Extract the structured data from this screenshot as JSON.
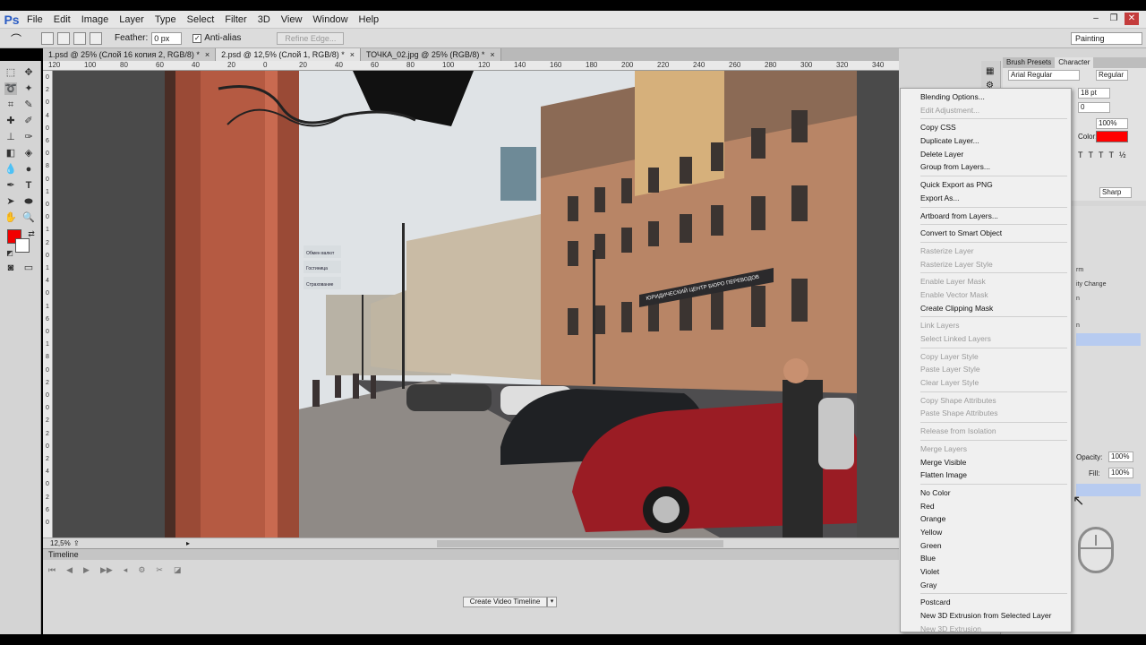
{
  "app": {
    "logo": "Ps"
  },
  "menubar": [
    "File",
    "Edit",
    "Image",
    "Layer",
    "Type",
    "Select",
    "Filter",
    "3D",
    "View",
    "Window",
    "Help"
  ],
  "window_controls": {
    "minimize": "–",
    "restore": "❐",
    "close": "✕"
  },
  "options_bar": {
    "feather_label": "Feather:",
    "feather_value": "0 px",
    "anti_alias_label": "Anti-alias",
    "anti_alias_checked": "✓",
    "refine_edge_label": "Refine Edge...",
    "workspace": "Painting"
  },
  "tabs": [
    {
      "label": "1.psd @ 25% (Слой 16 копия 2, RGB/8) *",
      "close": "×"
    },
    {
      "label": "2.psd @ 12,5% (Слой 1, RGB/8) *",
      "close": "×"
    },
    {
      "label": "ТОЧКА_02.jpg @ 25% (RGB/8) *",
      "close": "×"
    }
  ],
  "ruler_top": [
    "120",
    "100",
    "80",
    "60",
    "40",
    "20",
    "0",
    "20",
    "40",
    "60",
    "80",
    "100",
    "120",
    "140",
    "160",
    "180",
    "200",
    "220",
    "240",
    "260",
    "280",
    "300",
    "320",
    "340",
    "360",
    "370"
  ],
  "ruler_left": [
    "0",
    "2",
    "0",
    "4",
    "0",
    "6",
    "0",
    "8",
    "0",
    "1",
    "0",
    "0",
    "1",
    "2",
    "0",
    "1",
    "4",
    "0",
    "1",
    "6",
    "0",
    "1",
    "8",
    "0",
    "2",
    "0",
    "0",
    "2",
    "2",
    "0",
    "2",
    "4",
    "0",
    "2",
    "6",
    "0"
  ],
  "photo_signs": {
    "shop_sign": "ЮРИДИЧЕСКИЙ ЦЕНТР БЮРО ПЕРЕВОДОВ",
    "street_sign_1": "Обмен валют",
    "street_sign_2": "Гостиница",
    "street_sign_3": "Страхование"
  },
  "status": {
    "zoom": "12,5%"
  },
  "timeline": {
    "title": "Timeline",
    "create_button": "Create Video Timeline",
    "dropdown": "▾"
  },
  "character_panel": {
    "tabs": [
      "Brush Presets",
      "Character"
    ],
    "font_family": "Arial Regular",
    "font_style": "Regular",
    "font_size": "18 pt",
    "tracking": "0",
    "scale": "100%",
    "color_label": "Color:",
    "color": "#ff0000",
    "anti_alias": "Sharp",
    "type_buttons": [
      "T",
      "T",
      "T",
      "T",
      "½"
    ]
  },
  "layers_panel": {
    "rows": [
      "rm",
      "ity Change",
      "n",
      "n"
    ],
    "opacity_label": "Opacity:",
    "opacity_value": "100%",
    "fill_label": "Fill:",
    "fill_value": "100%"
  },
  "context_menu": [
    {
      "label": "Blending Options...",
      "disabled": false
    },
    {
      "label": "Edit Adjustment...",
      "disabled": true
    },
    {
      "sep": true
    },
    {
      "label": "Copy CSS",
      "disabled": false
    },
    {
      "label": "Duplicate Layer...",
      "disabled": false
    },
    {
      "label": "Delete Layer",
      "disabled": false
    },
    {
      "label": "Group from Layers...",
      "disabled": false
    },
    {
      "sep": true
    },
    {
      "label": "Quick Export as PNG",
      "disabled": false
    },
    {
      "label": "Export As...",
      "disabled": false
    },
    {
      "sep": true
    },
    {
      "label": "Artboard from Layers...",
      "disabled": false
    },
    {
      "sep": true
    },
    {
      "label": "Convert to Smart Object",
      "disabled": false
    },
    {
      "sep": true
    },
    {
      "label": "Rasterize Layer",
      "disabled": true
    },
    {
      "label": "Rasterize Layer Style",
      "disabled": true
    },
    {
      "sep": true
    },
    {
      "label": "Enable Layer Mask",
      "disabled": true
    },
    {
      "label": "Enable Vector Mask",
      "disabled": true
    },
    {
      "label": "Create Clipping Mask",
      "disabled": false
    },
    {
      "sep": true
    },
    {
      "label": "Link Layers",
      "disabled": true
    },
    {
      "label": "Select Linked Layers",
      "disabled": true
    },
    {
      "sep": true
    },
    {
      "label": "Copy Layer Style",
      "disabled": true
    },
    {
      "label": "Paste Layer Style",
      "disabled": true
    },
    {
      "label": "Clear Layer Style",
      "disabled": true
    },
    {
      "sep": true
    },
    {
      "label": "Copy Shape Attributes",
      "disabled": true
    },
    {
      "label": "Paste Shape Attributes",
      "disabled": true
    },
    {
      "sep": true
    },
    {
      "label": "Release from Isolation",
      "disabled": true
    },
    {
      "sep": true
    },
    {
      "label": "Merge Layers",
      "disabled": true
    },
    {
      "label": "Merge Visible",
      "disabled": false
    },
    {
      "label": "Flatten Image",
      "disabled": false
    },
    {
      "sep": true
    },
    {
      "label": "No Color",
      "disabled": false
    },
    {
      "label": "Red",
      "disabled": false
    },
    {
      "label": "Orange",
      "disabled": false
    },
    {
      "label": "Yellow",
      "disabled": false
    },
    {
      "label": "Green",
      "disabled": false
    },
    {
      "label": "Blue",
      "disabled": false
    },
    {
      "label": "Violet",
      "disabled": false
    },
    {
      "label": "Gray",
      "disabled": false
    },
    {
      "sep": true
    },
    {
      "label": "Postcard",
      "disabled": false
    },
    {
      "label": "New 3D Extrusion from Selected Layer",
      "disabled": false
    },
    {
      "label": "New 3D Extrusion",
      "disabled": true
    }
  ],
  "colors": {
    "foreground": "#f20000",
    "background": "#ffffff",
    "ps_blue": "#2a5cc4",
    "selection": "#b7cbf0"
  }
}
